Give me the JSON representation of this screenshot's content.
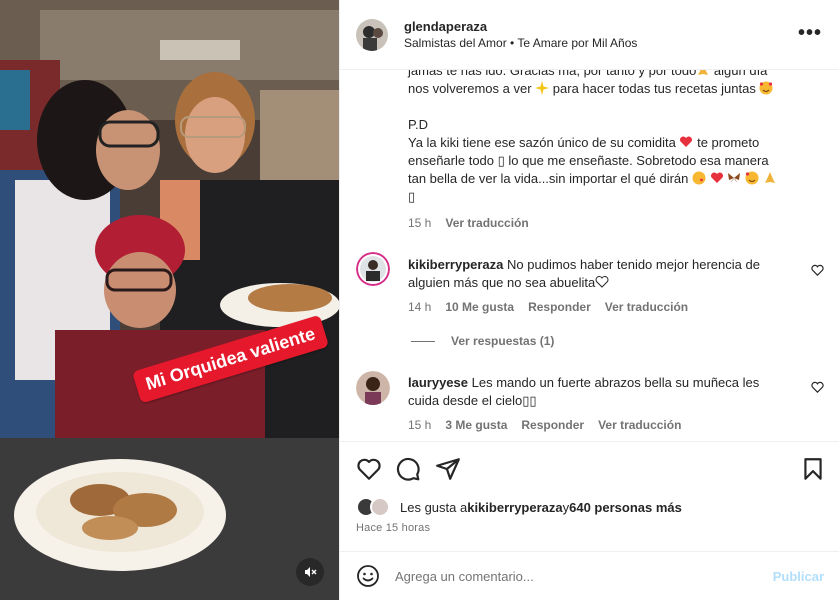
{
  "header": {
    "username": "glendaperaza",
    "audio": "Salmistas del Amor • Te Amare por Mil Años"
  },
  "media": {
    "sticker_text": "Mi Orquidea valiente"
  },
  "caption": {
    "line1": "jamás te has ido. Gracias ma, por tanto y por todo",
    "line2a": " algún día",
    "line2b": "nos volveremos a ver ",
    "line2c": " para hacer todas tus recetas juntas ",
    "pd": "P.D",
    "pd1a": "Ya la kiki tiene ese sazón único de su comidita ",
    "pd1b": " te prometo",
    "pd2": "enseñarle todo ▯ lo que me enseñaste. Sobretodo esa manera",
    "pd3": "tan bella de ver la vida...sin importar el qué dirán ",
    "pd4": "▯",
    "time": "15 h",
    "translate": "Ver traducción"
  },
  "comments": [
    {
      "username": "kikiberryperaza",
      "text_a": "No pudimos haber tenido mejor herencia de",
      "text_b": "alguien más que no sea abuelita",
      "time": "14 h",
      "likes": "10 Me gusta",
      "reply": "Responder",
      "translate": "Ver traducción"
    },
    {
      "username": "lauryyese",
      "text_a": "Les mando un fuerte abrazos bella su muñeca les",
      "text_b": "cuida desde el cielo▯▯",
      "time": "15 h",
      "likes": "3 Me gusta",
      "reply": "Responder",
      "translate": "Ver traducción"
    }
  ],
  "view_replies": "Ver respuestas (1)",
  "likes": {
    "prefix": "Les gusta a ",
    "user": "kikiberryperaza",
    "joiner": " y ",
    "others": "640 personas más"
  },
  "time_ago": "Hace 15 horas",
  "comment_box": {
    "placeholder": "Agrega un comentario...",
    "post": "Publicar"
  },
  "colors": {
    "sticker": "#e6192c",
    "post_disabled": "#b2dffc",
    "secondary_text": "#737373"
  },
  "icons": [
    "more-options-icon",
    "heart-icon",
    "comment-icon",
    "share-icon",
    "save-icon",
    "emoji-icon",
    "mute-icon"
  ]
}
